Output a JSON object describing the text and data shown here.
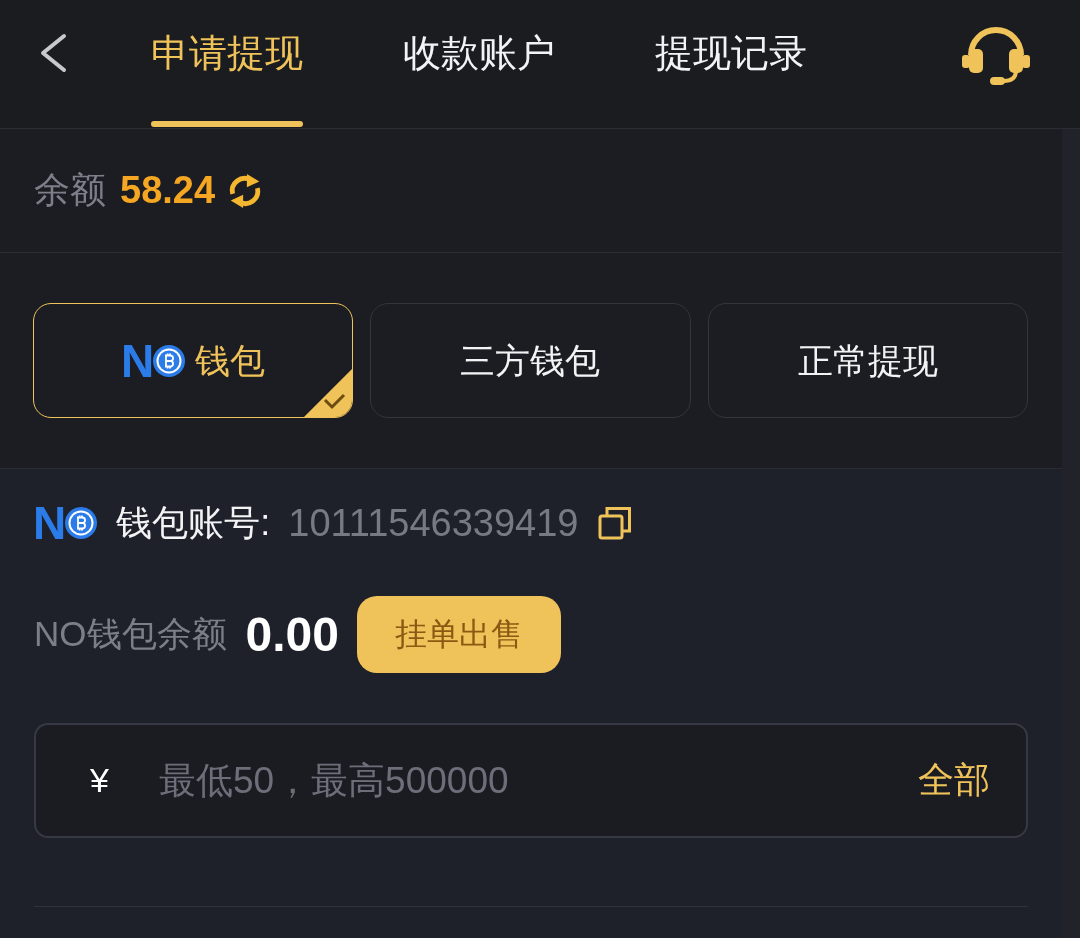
{
  "tabs": [
    {
      "label": "申请提现",
      "selected": true
    },
    {
      "label": "收款账户",
      "selected": false
    },
    {
      "label": "提现记录",
      "selected": false
    }
  ],
  "balance": {
    "label": "余额",
    "amount": "58.24"
  },
  "methods": [
    {
      "kind": "logo",
      "logo_letter": "N",
      "label": "钱包",
      "selected": true
    },
    {
      "kind": "text",
      "label": "三方钱包",
      "selected": false
    },
    {
      "kind": "text",
      "label": "正常提现",
      "selected": false
    }
  ],
  "wallet_account": {
    "logo_letter": "N",
    "label": "钱包账号:",
    "number": "10111546339419"
  },
  "wallet_balance": {
    "label": "NO钱包余额",
    "amount": "0.00",
    "button": "挂单出售"
  },
  "amount_field": {
    "currency": "¥",
    "placeholder": "最低50，最高500000",
    "action": "全部"
  }
}
